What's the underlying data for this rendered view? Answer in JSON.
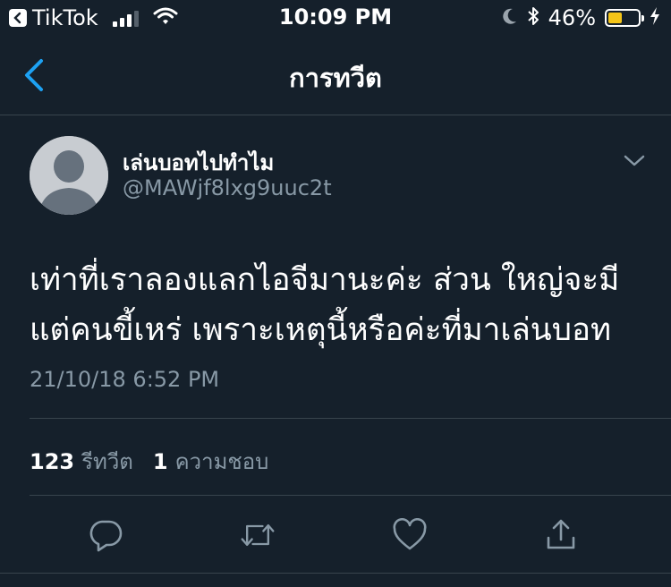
{
  "status_bar": {
    "app_name": "TikTok",
    "time": "10:09 PM",
    "battery_percent": "46%",
    "battery_level": 0.46,
    "signal_bars": 3,
    "colors": {
      "battery_fill": "#f5c518"
    }
  },
  "nav": {
    "title": "การทวีต",
    "back_icon": "chevron-left-icon"
  },
  "tweet": {
    "display_name": "เล่นบอทไปทำไม",
    "handle": "@MAWjf8lxg9uuc2t",
    "text_line1": "เท่าที่เราลองแลกไอจีมานะค่ะ ส่วน ใหญ่จะมี",
    "text_line2": "แต่คนขี้เหร่ เพราะเหตุนี้หรือค่ะที่มาเล่นบอท",
    "timestamp": "21/10/18 6:52 PM"
  },
  "stats": {
    "retweets_count": "123",
    "retweets_label": "รีทวีต",
    "likes_count": "1",
    "likes_label": "ความชอบ"
  },
  "actions": [
    "reply-icon",
    "retweet-icon",
    "like-icon",
    "share-icon"
  ],
  "colors": {
    "background": "#15202b",
    "accent": "#1da1f2",
    "secondary_text": "#8899a6",
    "divider": "#38444d"
  }
}
